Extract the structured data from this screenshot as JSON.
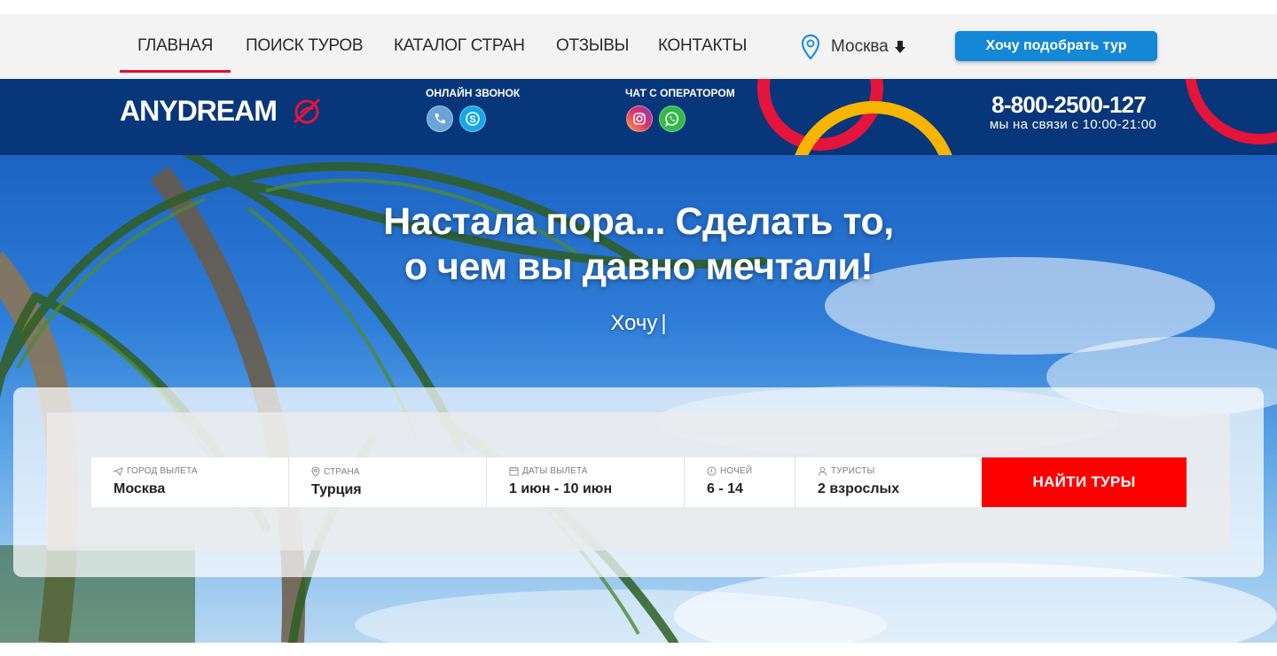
{
  "nav": {
    "items": [
      {
        "label": "ГЛАВНАЯ",
        "active": true
      },
      {
        "label": "ПОИСК ТУРОВ",
        "active": false
      },
      {
        "label": "КАТАЛОГ СТРАН",
        "active": false
      },
      {
        "label": "ОТЗЫВЫ",
        "active": false
      },
      {
        "label": "КОНТАКТЫ",
        "active": false
      }
    ],
    "city": "Москва",
    "pick_button": "Хочу подобрать тур"
  },
  "header": {
    "logo": "ANYDREAM",
    "online_call_label": "ОНЛАЙН ЗВОНОК",
    "chat_label": "ЧАТ С ОПЕРАТОРОМ",
    "phone": "8-800-2500-127",
    "hours": "мы на связи с 10:00-21:00"
  },
  "hero": {
    "title_line1": "Настала пора... Сделать то,",
    "title_line2": "о чем вы давно мечтали!",
    "typing_text": "Хочу",
    "typing_cursor": "|"
  },
  "search": {
    "fields": [
      {
        "label": "ГОРОД ВЫЛЕТА",
        "value": "Москва",
        "icon": "plane-icon"
      },
      {
        "label": "СТРАНА",
        "value": "Турция",
        "icon": "location-pin-icon"
      },
      {
        "label": "ДАТЫ ВЫЛЕТА",
        "value": "1 июн - 10 июн",
        "icon": "calendar-icon"
      },
      {
        "label": "НОЧЕЙ",
        "value": "6 - 14",
        "icon": "clock-icon"
      },
      {
        "label": "ТУРИСТЫ",
        "value": "2 взрослых",
        "icon": "user-icon"
      }
    ],
    "submit": "НАЙТИ ТУРЫ"
  },
  "colors": {
    "nav_active_underline": "#e0102e",
    "pick_button": "#1487d6",
    "header_bg": "#08367a",
    "find_button": "#ff0000"
  }
}
